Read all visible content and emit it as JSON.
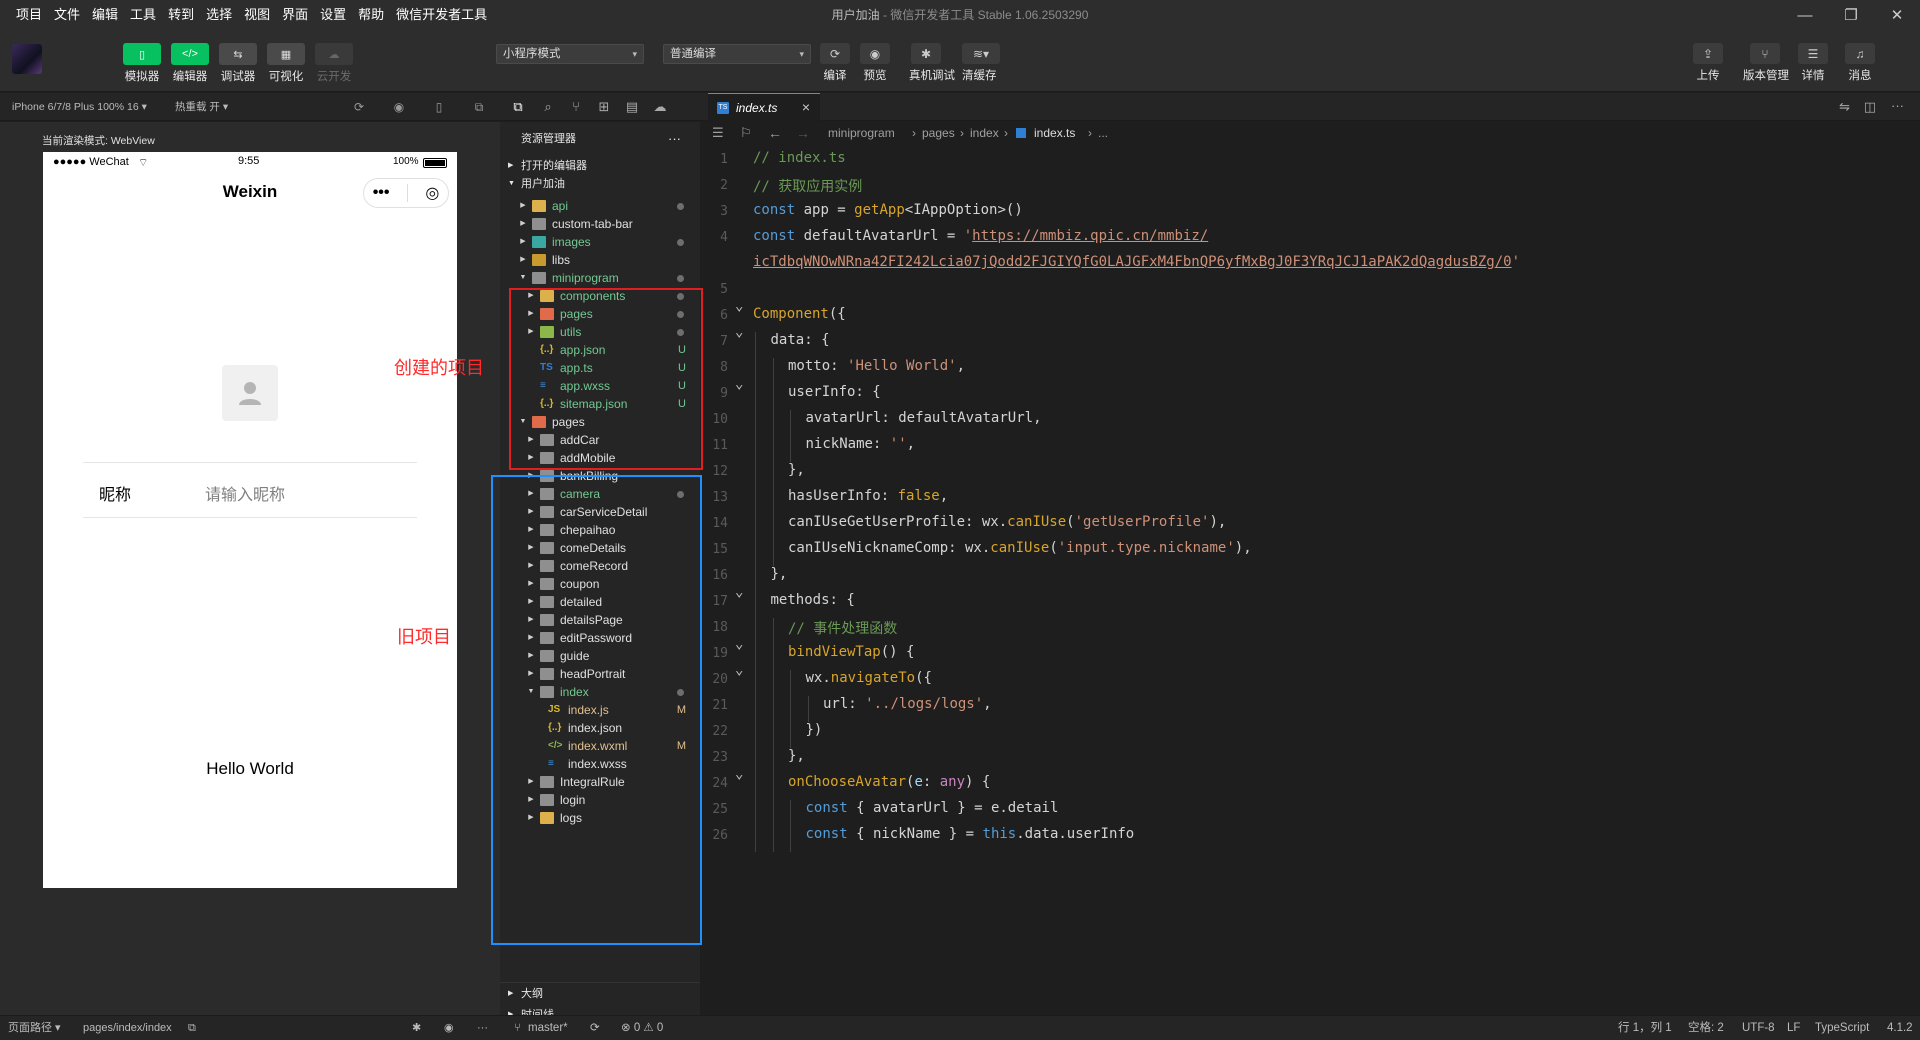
{
  "menu": [
    "项目",
    "文件",
    "编辑",
    "工具",
    "转到",
    "选择",
    "视图",
    "界面",
    "设置",
    "帮助",
    "微信开发者工具"
  ],
  "window_title": {
    "project": "用户加油",
    "sep": " - ",
    "app": "微信开发者工具 Stable 1.06.2503290"
  },
  "toolbar": {
    "simulator": "模拟器",
    "editor": "编辑器",
    "debugger": "调试器",
    "visualize": "可视化",
    "cloud": "云开发",
    "mode_select": "小程序模式",
    "compile_select": "普通编译",
    "compile": "编译",
    "preview": "预览",
    "remote_debug": "真机调试",
    "clear_cache": "清缓存",
    "upload": "上传",
    "version": "版本管理",
    "details": "详情",
    "messages": "消息"
  },
  "simulator": {
    "device": "iPhone 6/7/8 Plus 100% 16 ▾",
    "hot_reload": "热重载 开 ▾",
    "render_mode": "当前渲染模式: WebView",
    "status_carrier": "●●●●● WeChat",
    "status_time": "9:55",
    "status_battery": "100%",
    "nav_title": "Weixin",
    "nickname_label": "昵称",
    "nickname_placeholder": "请输入昵称",
    "hello": "Hello World"
  },
  "sim_footer": {
    "path_label": "页面路径 ▾",
    "path": "pages/index/index"
  },
  "explorer": {
    "title": "资源管理器",
    "open_editors": "打开的编辑器",
    "project": "用户加油",
    "outline": "大纲",
    "timeline": "时间线",
    "items": [
      {
        "label": "api",
        "depth": 1,
        "arrow": "▸",
        "color": "fold-y",
        "status": "dot"
      },
      {
        "label": "custom-tab-bar",
        "depth": 1,
        "arrow": "▸",
        "color": "fold",
        "status": ""
      },
      {
        "label": "images",
        "depth": 1,
        "arrow": "▸",
        "color": "fold-t",
        "status": "dot"
      },
      {
        "label": "libs",
        "depth": 1,
        "arrow": "▸",
        "color": "fold-o",
        "status": ""
      },
      {
        "label": "miniprogram",
        "depth": 1,
        "arrow": "▾",
        "color": "fold",
        "status": "dot"
      },
      {
        "label": "components",
        "depth": 2,
        "arrow": "▸",
        "color": "fold-y",
        "status": "dot"
      },
      {
        "label": "pages",
        "depth": 2,
        "arrow": "▸",
        "color": "fold-r",
        "status": "dot"
      },
      {
        "label": "utils",
        "depth": 2,
        "arrow": "▸",
        "color": "fold-g",
        "status": "dot"
      },
      {
        "label": "app.json",
        "depth": 2,
        "arrow": "",
        "color": "file-json",
        "status": "U"
      },
      {
        "label": "app.ts",
        "depth": 2,
        "arrow": "",
        "color": "file-ts",
        "status": "U"
      },
      {
        "label": "app.wxss",
        "depth": 2,
        "arrow": "",
        "color": "file-wxss",
        "status": "U"
      },
      {
        "label": "sitemap.json",
        "depth": 2,
        "arrow": "",
        "color": "file-json",
        "status": "U"
      },
      {
        "label": "pages",
        "depth": 1,
        "arrow": "▾",
        "color": "fold-r",
        "status": ""
      },
      {
        "label": "addCar",
        "depth": 2,
        "arrow": "▸",
        "color": "fold",
        "status": ""
      },
      {
        "label": "addMobile",
        "depth": 2,
        "arrow": "▸",
        "color": "fold",
        "status": ""
      },
      {
        "label": "bankBilling",
        "depth": 2,
        "arrow": "▸",
        "color": "fold",
        "status": ""
      },
      {
        "label": "camera",
        "depth": 2,
        "arrow": "▸",
        "color": "fold",
        "status": "dot"
      },
      {
        "label": "carServiceDetail",
        "depth": 2,
        "arrow": "▸",
        "color": "fold",
        "status": ""
      },
      {
        "label": "chepaihao",
        "depth": 2,
        "arrow": "▸",
        "color": "fold",
        "status": ""
      },
      {
        "label": "comeDetails",
        "depth": 2,
        "arrow": "▸",
        "color": "fold",
        "status": ""
      },
      {
        "label": "comeRecord",
        "depth": 2,
        "arrow": "▸",
        "color": "fold",
        "status": ""
      },
      {
        "label": "coupon",
        "depth": 2,
        "arrow": "▸",
        "color": "fold",
        "status": ""
      },
      {
        "label": "detailed",
        "depth": 2,
        "arrow": "▸",
        "color": "fold",
        "status": ""
      },
      {
        "label": "detailsPage",
        "depth": 2,
        "arrow": "▸",
        "color": "fold",
        "status": ""
      },
      {
        "label": "editPassword",
        "depth": 2,
        "arrow": "▸",
        "color": "fold",
        "status": ""
      },
      {
        "label": "guide",
        "depth": 2,
        "arrow": "▸",
        "color": "fold",
        "status": ""
      },
      {
        "label": "headPortrait",
        "depth": 2,
        "arrow": "▸",
        "color": "fold",
        "status": ""
      },
      {
        "label": "index",
        "depth": 2,
        "arrow": "▾",
        "color": "fold",
        "status": "dot"
      },
      {
        "label": "index.js",
        "depth": 3,
        "arrow": "",
        "color": "file-js",
        "status": "M"
      },
      {
        "label": "index.json",
        "depth": 3,
        "arrow": "",
        "color": "file-json",
        "status": ""
      },
      {
        "label": "index.wxml",
        "depth": 3,
        "arrow": "",
        "color": "file-wxml",
        "status": "M"
      },
      {
        "label": "index.wxss",
        "depth": 3,
        "arrow": "",
        "color": "file-wxss",
        "status": ""
      },
      {
        "label": "IntegralRule",
        "depth": 2,
        "arrow": "▸",
        "color": "fold",
        "status": ""
      },
      {
        "label": "login",
        "depth": 2,
        "arrow": "▸",
        "color": "fold",
        "status": ""
      },
      {
        "label": "logs",
        "depth": 2,
        "arrow": "▸",
        "color": "fold-y",
        "status": ""
      }
    ]
  },
  "editor": {
    "tab": "index.ts",
    "breadcrumbs": [
      "miniprogram",
      "pages",
      "index",
      "index.ts",
      "..."
    ],
    "lines": [
      {
        "n": "1",
        "fold": "",
        "indent": 0,
        "parts": [
          [
            "cm",
            "// index.ts"
          ]
        ]
      },
      {
        "n": "2",
        "fold": "",
        "indent": 0,
        "parts": [
          [
            "cm",
            "// 获取应用实例"
          ]
        ]
      },
      {
        "n": "3",
        "fold": "",
        "indent": 0,
        "parts": [
          [
            "kw",
            "const"
          ],
          [
            "prop",
            " app = "
          ],
          [
            "fn2",
            "getApp"
          ],
          [
            "prop",
            "<"
          ],
          [
            "prop",
            "IAppOption"
          ],
          [
            "prop",
            ">()"
          ]
        ]
      },
      {
        "n": "4",
        "fold": "",
        "indent": 0,
        "parts": [
          [
            "kw",
            "const"
          ],
          [
            "prop",
            " defaultAvatarUrl = "
          ],
          [
            "str",
            "'"
          ],
          [
            "url",
            "https://mmbiz.qpic.cn/mmbiz/"
          ]
        ]
      },
      {
        "n": "",
        "fold": "",
        "indent": 0,
        "parts": [
          [
            "url",
            "icTdbqWNOwNRna42FI242Lcia07jQodd2FJGIYQfG0LAJGFxM4FbnQP6yfMxBgJ0F3YRqJCJ1aPAK2dQagdusBZg/0"
          ],
          [
            "str",
            "'"
          ]
        ]
      },
      {
        "n": "5",
        "fold": "",
        "indent": 0,
        "parts": []
      },
      {
        "n": "6",
        "fold": "v",
        "indent": 0,
        "parts": [
          [
            "fn2",
            "Component"
          ],
          [
            "prop",
            "({"
          ]
        ]
      },
      {
        "n": "7",
        "fold": "v",
        "indent": 1,
        "parts": [
          [
            "prop",
            "data: {"
          ]
        ]
      },
      {
        "n": "8",
        "fold": "",
        "indent": 2,
        "parts": [
          [
            "prop",
            "motto: "
          ],
          [
            "str",
            "'Hello World'"
          ],
          [
            "prop",
            ","
          ]
        ]
      },
      {
        "n": "9",
        "fold": "v",
        "indent": 2,
        "parts": [
          [
            "prop",
            "userInfo: {"
          ]
        ]
      },
      {
        "n": "10",
        "fold": "",
        "indent": 3,
        "parts": [
          [
            "prop",
            "avatarUrl: defaultAvatarUrl,"
          ]
        ]
      },
      {
        "n": "11",
        "fold": "",
        "indent": 3,
        "parts": [
          [
            "prop",
            "nickName: "
          ],
          [
            "str",
            "''"
          ],
          [
            "prop",
            ","
          ]
        ]
      },
      {
        "n": "12",
        "fold": "",
        "indent": 2,
        "parts": [
          [
            "prop",
            "},"
          ]
        ]
      },
      {
        "n": "13",
        "fold": "",
        "indent": 2,
        "parts": [
          [
            "prop",
            "hasUserInfo: "
          ],
          [
            "fn2",
            "false"
          ],
          [
            "prop",
            ","
          ]
        ]
      },
      {
        "n": "14",
        "fold": "",
        "indent": 2,
        "parts": [
          [
            "prop",
            "canIUseGetUserProfile: wx."
          ],
          [
            "fn2",
            "canIUse"
          ],
          [
            "prop",
            "("
          ],
          [
            "str",
            "'getUserProfile'"
          ],
          [
            "prop",
            "),"
          ]
        ]
      },
      {
        "n": "15",
        "fold": "",
        "indent": 2,
        "parts": [
          [
            "prop",
            "canIUseNicknameComp: wx."
          ],
          [
            "fn2",
            "canIUse"
          ],
          [
            "prop",
            "("
          ],
          [
            "str",
            "'input.type.nickname'"
          ],
          [
            "prop",
            "),"
          ]
        ]
      },
      {
        "n": "16",
        "fold": "",
        "indent": 1,
        "parts": [
          [
            "prop",
            "},"
          ]
        ]
      },
      {
        "n": "17",
        "fold": "v",
        "indent": 1,
        "parts": [
          [
            "prop",
            "methods: {"
          ]
        ]
      },
      {
        "n": "18",
        "fold": "",
        "indent": 2,
        "parts": [
          [
            "cm",
            "// 事件处理函数"
          ]
        ]
      },
      {
        "n": "19",
        "fold": "v",
        "indent": 2,
        "parts": [
          [
            "fn2",
            "bindViewTap"
          ],
          [
            "prop",
            "() {"
          ]
        ]
      },
      {
        "n": "20",
        "fold": "v",
        "indent": 3,
        "parts": [
          [
            "prop",
            "wx."
          ],
          [
            "fn2",
            "navigateTo"
          ],
          [
            "prop",
            "({"
          ]
        ]
      },
      {
        "n": "21",
        "fold": "",
        "indent": 4,
        "parts": [
          [
            "prop",
            "url: "
          ],
          [
            "str",
            "'../logs/logs'"
          ],
          [
            "prop",
            ","
          ]
        ]
      },
      {
        "n": "22",
        "fold": "",
        "indent": 3,
        "parts": [
          [
            "prop",
            "})"
          ]
        ]
      },
      {
        "n": "23",
        "fold": "",
        "indent": 2,
        "parts": [
          [
            "prop",
            "},"
          ]
        ]
      },
      {
        "n": "24",
        "fold": "v",
        "indent": 2,
        "parts": [
          [
            "fn2",
            "onChooseAvatar"
          ],
          [
            "prop",
            "("
          ],
          [
            "var",
            "e"
          ],
          [
            "prop",
            ": "
          ],
          [
            "kw2",
            "any"
          ],
          [
            "prop",
            ") {"
          ]
        ]
      },
      {
        "n": "25",
        "fold": "",
        "indent": 3,
        "parts": [
          [
            "kw",
            "const"
          ],
          [
            "prop",
            " { avatarUrl } = e.detail"
          ]
        ]
      },
      {
        "n": "26",
        "fold": "",
        "indent": 3,
        "parts": [
          [
            "kw",
            "const"
          ],
          [
            "prop",
            " { nickName } = "
          ],
          [
            "kw",
            "this"
          ],
          [
            "prop",
            ".data.userInfo"
          ]
        ]
      }
    ]
  },
  "statusbar": {
    "branch": "master*",
    "problems": "⊗ 0 ⚠ 0",
    "position": "行 1，列 1",
    "spaces": "空格: 2",
    "encoding": "UTF-8",
    "eol": "LF",
    "language": "TypeScript",
    "version": "4.1.2"
  },
  "annotations": {
    "new_project": "创建的项目",
    "old_project": "旧项目",
    "red": "#e02020",
    "blue": "#1e90ff"
  }
}
